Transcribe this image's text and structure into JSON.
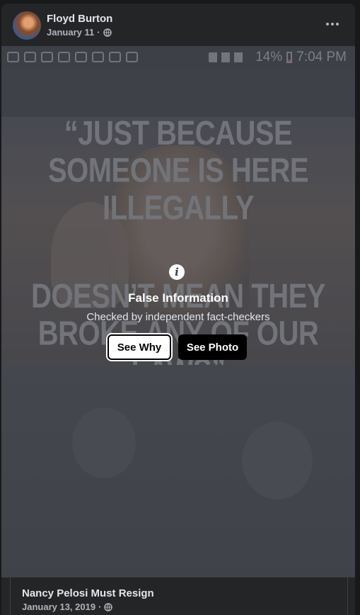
{
  "post": {
    "author": "Floyd Burton",
    "date": "January 11",
    "separator": "·",
    "privacy_icon": "globe-icon",
    "more_icon": "more-horizontal-icon"
  },
  "screenshot_status": {
    "battery": "14%",
    "time": "7:04 PM"
  },
  "meme": {
    "top_text": "“JUST BECAUSE SOMEONE IS HERE ILLEGALLY",
    "bottom_text": "DOESN’T MEAN THEY BROKE ANY OF OUR LAWS”"
  },
  "warning": {
    "icon": "info-icon",
    "title": "False Information",
    "subtitle": "Checked by independent fact-checkers",
    "see_why": "See Why",
    "see_photo": "See Photo"
  },
  "shared_post": {
    "title": "Nancy Pelosi Must Resign",
    "date": "January 13, 2019",
    "separator": "·"
  }
}
